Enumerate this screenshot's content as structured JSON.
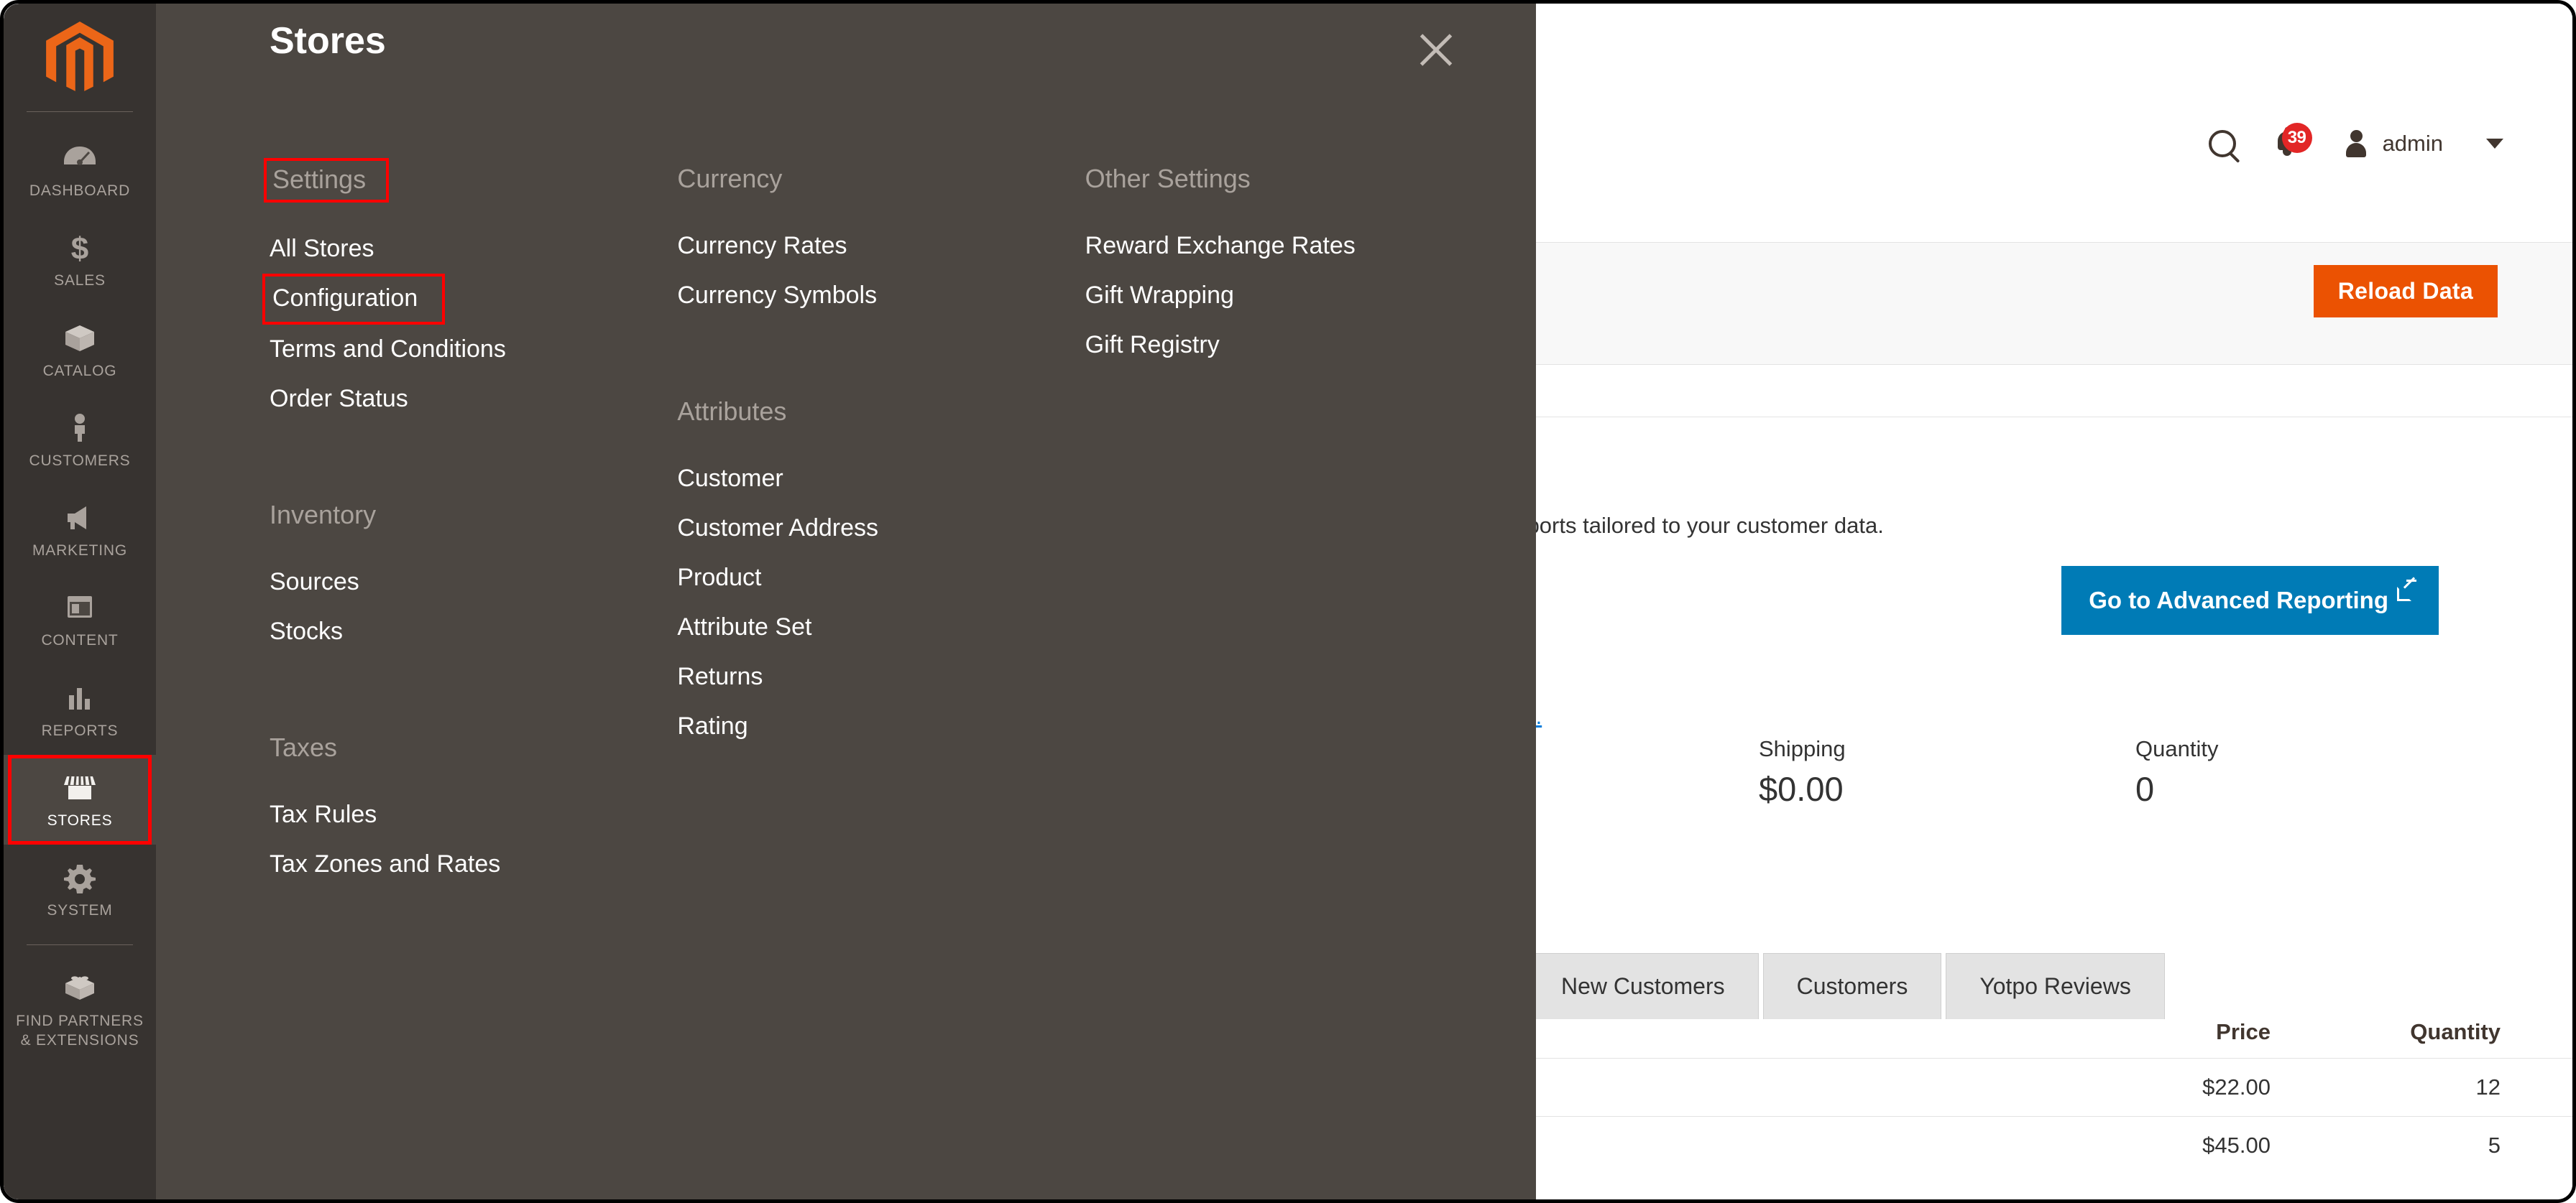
{
  "sidebar": {
    "logo_icon": "magento-logo-icon",
    "items": [
      {
        "label": "DASHBOARD",
        "icon": "gauge-icon",
        "active": false,
        "highlighted": false
      },
      {
        "label": "SALES",
        "icon": "dollar-icon",
        "active": false,
        "highlighted": false
      },
      {
        "label": "CATALOG",
        "icon": "box-icon",
        "active": false,
        "highlighted": false
      },
      {
        "label": "CUSTOMERS",
        "icon": "person-icon",
        "active": false,
        "highlighted": false
      },
      {
        "label": "MARKETING",
        "icon": "megaphone-icon",
        "active": false,
        "highlighted": false
      },
      {
        "label": "CONTENT",
        "icon": "window-icon",
        "active": false,
        "highlighted": false
      },
      {
        "label": "REPORTS",
        "icon": "bar-chart-icon",
        "active": false,
        "highlighted": false
      },
      {
        "label": "STORES",
        "icon": "storefront-icon",
        "active": true,
        "highlighted": true
      },
      {
        "label": "SYSTEM",
        "icon": "gear-icon",
        "active": false,
        "highlighted": false
      },
      {
        "label": "FIND PARTNERS\n& EXTENSIONS",
        "icon": "lego-brick-icon",
        "active": false,
        "highlighted": false
      }
    ]
  },
  "menu_panel": {
    "title": "Stores",
    "close_icon": "close-icon",
    "columns": [
      {
        "groups": [
          {
            "title": "Settings",
            "title_highlighted": true,
            "items": [
              {
                "label": "All Stores",
                "highlighted": false
              },
              {
                "label": "Configuration",
                "highlighted": true
              },
              {
                "label": "Terms and Conditions",
                "highlighted": false
              },
              {
                "label": "Order Status",
                "highlighted": false
              }
            ]
          },
          {
            "title": "Inventory",
            "title_highlighted": false,
            "items": [
              {
                "label": "Sources",
                "highlighted": false
              },
              {
                "label": "Stocks",
                "highlighted": false
              }
            ]
          },
          {
            "title": "Taxes",
            "title_highlighted": false,
            "items": [
              {
                "label": "Tax Rules",
                "highlighted": false
              },
              {
                "label": "Tax Zones and Rates",
                "highlighted": false
              }
            ]
          }
        ]
      },
      {
        "groups": [
          {
            "title": "Currency",
            "title_highlighted": false,
            "items": [
              {
                "label": "Currency Rates",
                "highlighted": false
              },
              {
                "label": "Currency Symbols",
                "highlighted": false
              }
            ]
          },
          {
            "title": "Attributes",
            "title_highlighted": false,
            "items": [
              {
                "label": "Customer",
                "highlighted": false
              },
              {
                "label": "Customer Address",
                "highlighted": false
              },
              {
                "label": "Product",
                "highlighted": false
              },
              {
                "label": "Attribute Set",
                "highlighted": false
              },
              {
                "label": "Returns",
                "highlighted": false
              },
              {
                "label": "Rating",
                "highlighted": false
              }
            ]
          }
        ]
      },
      {
        "groups": [
          {
            "title": "Other Settings",
            "title_highlighted": false,
            "items": [
              {
                "label": "Reward Exchange Rates",
                "highlighted": false
              },
              {
                "label": "Gift Wrapping",
                "highlighted": false
              },
              {
                "label": "Gift Registry",
                "highlighted": false
              }
            ]
          }
        ]
      }
    ]
  },
  "dashboard": {
    "header": {
      "search_icon": "search-icon",
      "notifications_icon": "bell-icon",
      "notifications_count": "39",
      "avatar_icon": "user-avatar-icon",
      "user_name": "admin",
      "caret_icon": "chevron-down-icon"
    },
    "toolbar": {
      "reload_label": "Reload Data"
    },
    "advanced_reporting": {
      "description_fragment": "reports tailored to your customer data.",
      "button_label": "Go to Advanced Reporting",
      "external_link_icon": "external-link-icon",
      "link_fragment": "re."
    },
    "stats": [
      {
        "label": "Shipping",
        "value": "$0.00"
      },
      {
        "label": "Quantity",
        "value": "0"
      }
    ],
    "tabs": [
      {
        "label": "New Customers",
        "selected": false
      },
      {
        "label": "Customers",
        "selected": false
      },
      {
        "label": "Yotpo Reviews",
        "selected": false
      }
    ],
    "table": {
      "headers": [
        "Price",
        "Quantity"
      ],
      "rows": [
        {
          "price": "$22.00",
          "quantity": "12"
        },
        {
          "price": "$45.00",
          "quantity": "5"
        }
      ]
    }
  },
  "colors": {
    "brand_orange": "#eb5202",
    "link_blue": "#007bdb",
    "button_blue": "#007bb6",
    "sidebar_bg": "#373330",
    "panel_bg": "#4c4742",
    "badge_red": "#e22626",
    "highlight_red": "#ff0000"
  }
}
